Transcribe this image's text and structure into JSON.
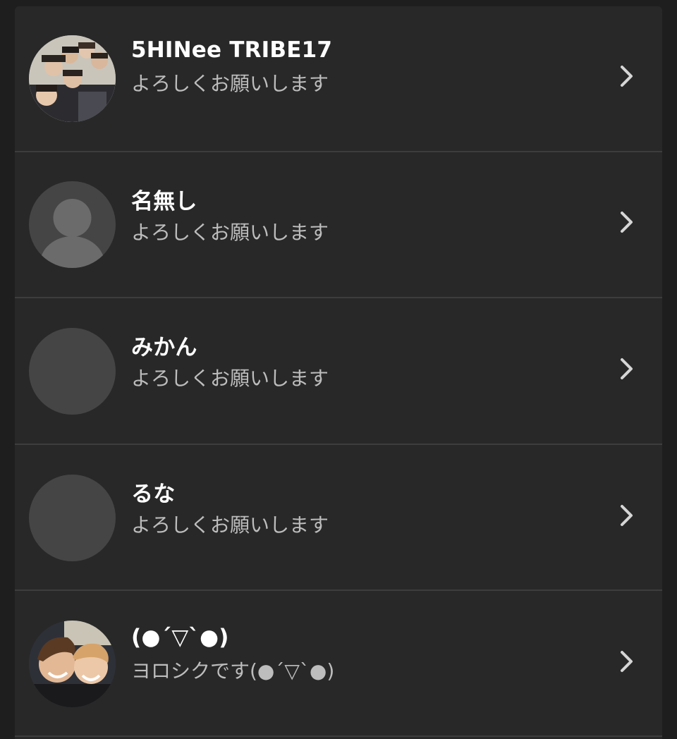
{
  "contacts": [
    {
      "name": "5HINee TRIBE17",
      "message": "よろしくお願いします",
      "avatar": "group-photo"
    },
    {
      "name": "名無し",
      "message": "よろしくお願いします",
      "avatar": "default-person"
    },
    {
      "name": "みかん",
      "message": "よろしくお願いします",
      "avatar": "blank"
    },
    {
      "name": "るな",
      "message": "よろしくお願いします",
      "avatar": "blank"
    },
    {
      "name": "(●´▽`●)",
      "message": "ヨロシクです(●´▽`●)",
      "avatar": "duo-photo"
    }
  ],
  "icons": {
    "chevron": "chevron-right-icon",
    "default_avatar": "person-icon"
  },
  "colors": {
    "background": "#1e1e1e",
    "panel": "#282828",
    "divider": "#3d3d3d",
    "name_text": "#ffffff",
    "message_text": "#bdbdbd",
    "avatar_placeholder": "#454545"
  }
}
